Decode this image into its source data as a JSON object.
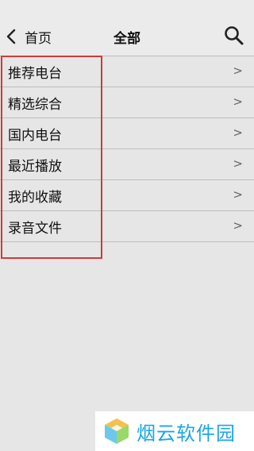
{
  "nav": {
    "back_label": "首页",
    "title": "全部"
  },
  "list": {
    "items": [
      {
        "label": "推荐电台",
        "chevron": ">"
      },
      {
        "label": "精选综合",
        "chevron": ">"
      },
      {
        "label": "国内电台",
        "chevron": ">"
      },
      {
        "label": "最近播放",
        "chevron": ">"
      },
      {
        "label": "我的收藏",
        "chevron": ">"
      },
      {
        "label": "录音文件",
        "chevron": ">"
      }
    ]
  },
  "watermark": {
    "text": "烟云软件园"
  },
  "colors": {
    "highlight_border": "#d03a3a",
    "watermark_text": "#1aa6e8"
  },
  "icons": {
    "back": "chevron-left-icon",
    "search": "search-icon",
    "row": "chevron-right-icon",
    "watermark": "cube-logo-icon"
  }
}
